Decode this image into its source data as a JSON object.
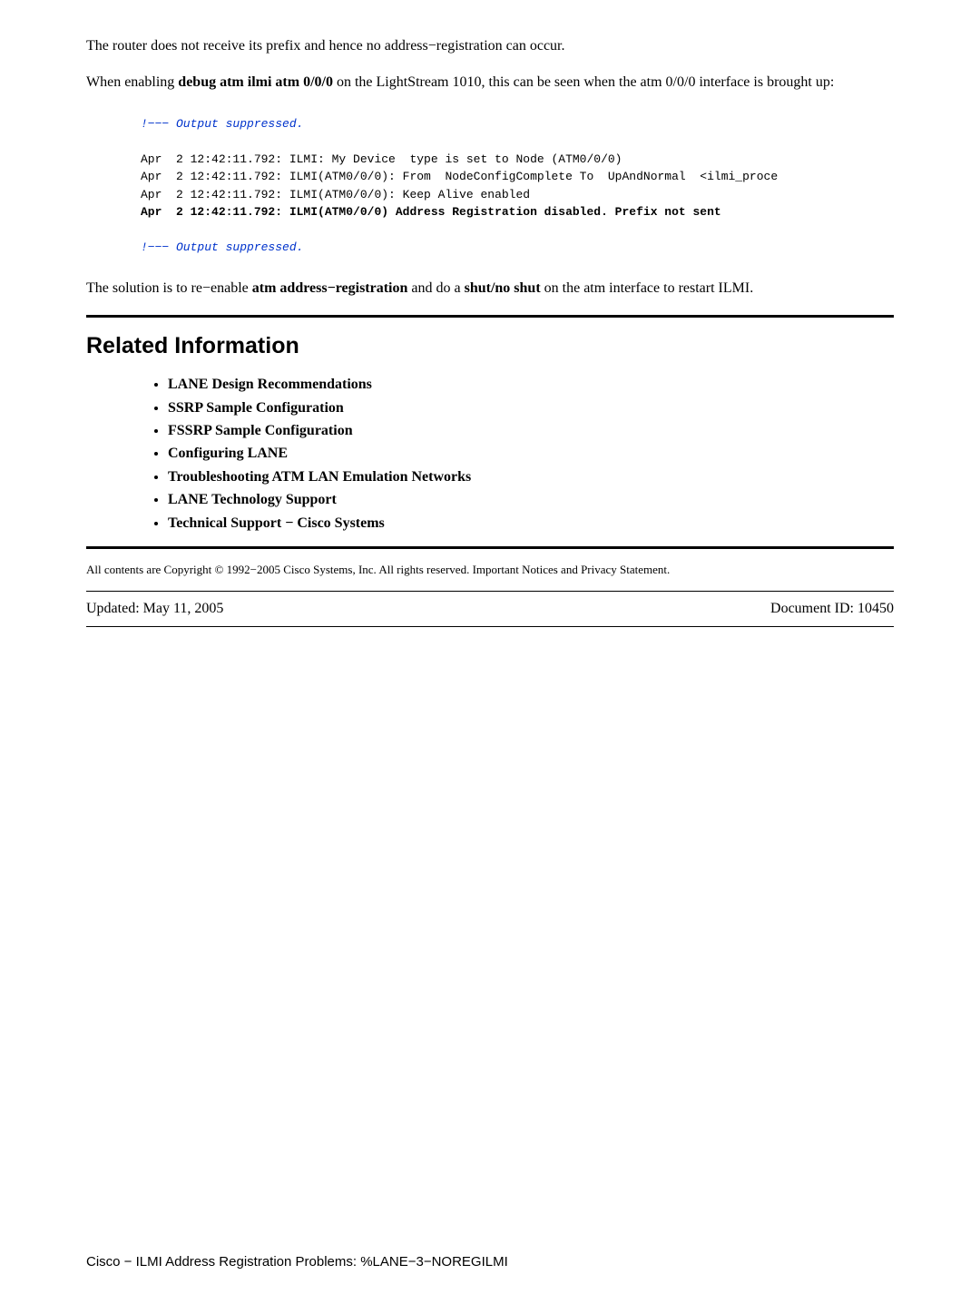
{
  "intro": {
    "line1": "The router does not receive its prefix and hence no address−registration can occur.",
    "line2_pre": "When enabling ",
    "line2_cmd": "debug atm ilmi atm 0/0/0",
    "line2_post": " on the LightStream 1010, this can be seen when the atm 0/0/0 interface is brought up:"
  },
  "code": {
    "comment1": "!−−− Output suppressed.",
    "l1": "Apr  2 12:42:11.792: ILMI: My Device  type is set to Node (ATM0/0/0)",
    "l2": "Apr  2 12:42:11.792: ILMI(ATM0/0/0): From  NodeConfigComplete To  UpAndNormal  <ilmi_proce",
    "l3": "Apr  2 12:42:11.792: ILMI(ATM0/0/0): Keep Alive enabled",
    "l4": "Apr  2 12:42:11.792: ILMI(ATM0/0/0) Address Registration disabled. Prefix not sent",
    "comment2": "!−−− Output suppressed."
  },
  "solution": {
    "pre": "The solution is to re−enable ",
    "b1": "atm address−registration",
    "mid1": " and do a ",
    "b2": "shut/no shut",
    "mid2": " on the atm interface to restart ILMI."
  },
  "related": {
    "heading": "Related Information",
    "items": [
      "LANE Design Recommendations",
      "SSRP Sample Configuration",
      "FSSRP Sample Configuration",
      "Configuring LANE",
      "Troubleshooting ATM LAN Emulation Networks",
      "LANE Technology Support",
      "Technical Support − Cisco Systems"
    ]
  },
  "copyright": "All contents are Copyright © 1992−2005 Cisco Systems, Inc. All rights reserved. Important Notices and Privacy Statement.",
  "footer": {
    "updated": "Updated: May 11, 2005",
    "docid": "Document ID: 10450"
  },
  "page_footer": "Cisco − ILMI Address Registration Problems: %LANE−3−NOREGILMI"
}
